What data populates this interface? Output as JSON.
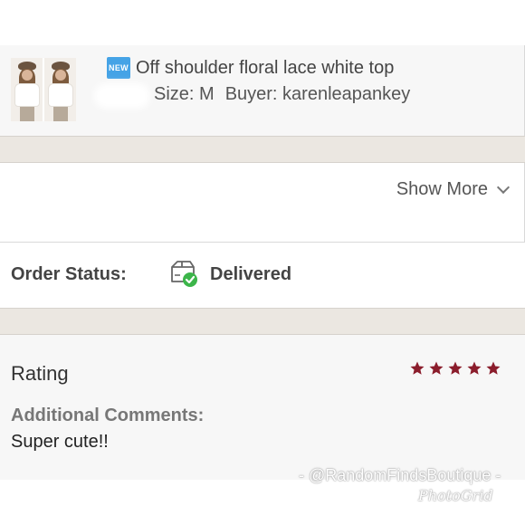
{
  "listing": {
    "badge": "NEW",
    "title": "Off shoulder floral lace white top",
    "size": "Size: M",
    "buyer": "Buyer: karenleapankey"
  },
  "buyer_section": {
    "show_more_label": "Show More"
  },
  "order_status": {
    "label": "Order Status:",
    "value": "Delivered",
    "icon": "delivered-box-icon",
    "check_color": "#3cb54a"
  },
  "rating": {
    "title": "Rating",
    "stars": 5,
    "max_stars": 5,
    "star_color": "#8b1d2c",
    "comments_label": "Additional Comments:",
    "comment": "Super cute!!"
  },
  "watermark": {
    "handle": "- @RandomFindsBoutique -",
    "app": "PhotoGrid"
  }
}
